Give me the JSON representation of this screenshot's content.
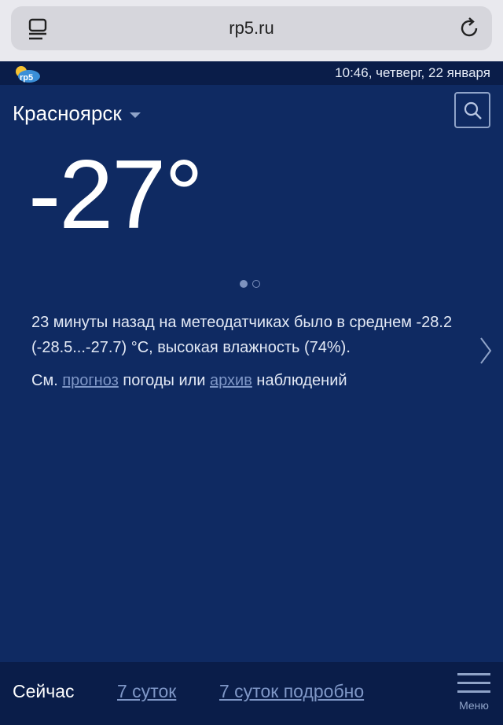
{
  "browser": {
    "url": "rp5.ru",
    "tabs_icon": "tabs-icon",
    "reload_icon": "reload-icon"
  },
  "header": {
    "logo_text": "rp5",
    "datetime": "10:46, четверг, 22 января"
  },
  "location": {
    "city": "Красноярск",
    "search_icon": "search-icon"
  },
  "current": {
    "temperature": "-27°"
  },
  "carousel": {
    "total": 2,
    "active": 1
  },
  "observation": {
    "text": "23 минуты назад на метеодатчиках было в среднем -28.2 (-28.5...-27.7) °C, высокая влажность (74%).",
    "see": "См.",
    "forecast_link": "прогноз",
    "mid": "погоды или",
    "archive_link": "архив",
    "tail": "наблюдений"
  },
  "nav": {
    "current": "Сейчас",
    "week": "7 суток",
    "week_detail": "7 суток подробно",
    "menu": "Меню"
  },
  "colors": {
    "background": "#0f2a62",
    "strip": "#0a1d49",
    "link": "#7f97c7"
  }
}
